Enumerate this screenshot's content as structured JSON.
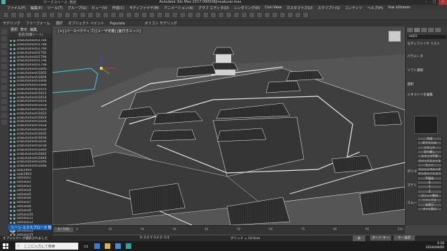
{
  "window": {
    "title": "Autodesk 3ds Max 2017    090506Jinsakurai.max",
    "workspace_label": "ワークスペース: 既定"
  },
  "menubar": [
    "ファイル(F)",
    "編集(E)",
    "ツール(T)",
    "グループ(G)",
    "ビュー(V)",
    "作成(C)",
    "モディファイヤ(M)",
    "アニメーション(A)",
    "グラフ エディタ(D)",
    "レンダリング(R)",
    "Civil View",
    "カスタマイズ(U)",
    "スクリプト(S)",
    "コンテンツ",
    "ヘルプ(H)",
    "Vue xStream"
  ],
  "ribbon": [
    "モデリング",
    "フリーフォーム",
    "選択",
    "オブジェクト ペイント",
    "Populate"
  ],
  "ribbon_sub": "ポリゴン モデリング",
  "explorer": {
    "tabs": [
      "選択",
      "表示",
      "編集"
    ],
    "header": "名前(昇順ソート)",
    "items": [
      "arakuhoheshi1786",
      "arakuhoheshi1788",
      "arakuhoheshi1790",
      "arakuhoheshi1792",
      "arakuhoheshi1794",
      "arakuhoheshi1796",
      "arakuhoheshi1798",
      "arakuhoheshi1800",
      "arakuhoheshi1802",
      "arakuhoheshi1804",
      "arakuhoheshi1806",
      "arakuhoheshi1808",
      "arakuhoheshi1810",
      "arakuhoheshi1812",
      "arakuhoheshi1814",
      "arakuhoheshi1816",
      "arakuhoheshi1818",
      "arakuhoheshi1820",
      "arakuhoheshi1822",
      "arakuhoheshi1824",
      "arakuhoheshi1826",
      "arakuhoheshi1828",
      "arakuhoheshi1830",
      "arakuhoheshi1832",
      "arakuhoheshi1834",
      "arakuhoheshi1836",
      "arakuhoheshi1838",
      "arakuhoheshi1840",
      "arakuhoheshi1842",
      "arakuhoheshi1844",
      "arakuhoheshi1846",
      "arakuhoheshi1848",
      "aoki2900",
      "aoki2902",
      "ashioka1",
      "ashioka2",
      "ashioka3",
      "ashioka4",
      "ashioka5",
      "ashioka6",
      "ashioka7",
      "ashioka8",
      "ashioka9",
      "ashioka10",
      "ashioka11",
      "ashioka12",
      "ashioka13",
      "ashioka14",
      "ashioka15",
      "ashioka16"
    ],
    "status": "シーン エクスプローラ  既定"
  },
  "viewport": {
    "label": "[+] [パースペクティブ] [ユーザ定義] [面付きエッジ]",
    "colors": {
      "bg": "#4b4b4b",
      "roof": "#2a2a2a",
      "wall": "#e0e0e0",
      "selection": "#2fd3e6",
      "gizmo_x": "#e03030",
      "gizmo_y": "#30c030",
      "gizmo_z": "#3050e0"
    }
  },
  "cmdpanel": {
    "name": "obj01",
    "sections": [
      "モディファイヤ リスト",
      "パラメータ",
      "ソフト選択",
      "選択",
      "ジオメトリを編集",
      "ポリゴン",
      "マテリアル ID",
      "スムージング グループ"
    ],
    "buttons": [
      "作成",
      "折りたたみ",
      "アタッチ",
      "切り離し",
      "スライス平面",
      "クイックスライス",
      "カット",
      "メッシュスムーズ",
      "テッセレーション",
      "平面化",
      "X",
      "Y",
      "Z",
      "グリッド整列",
      "リラックス",
      "非表示",
      "すべて表示"
    ]
  },
  "timeline": {
    "frame": "0 / 100",
    "ticks": [
      "0",
      "10",
      "20",
      "30",
      "40",
      "50",
      "60",
      "70",
      "80",
      "90",
      "100"
    ]
  },
  "status": {
    "left": "オブジェクトが選択されました",
    "coords": "X: 0.0   Y: 0.0   Z: 0.0",
    "grid": "グリッド = 10.0cm",
    "autokey": "オート キー",
    "setkey": "キー設定"
  },
  "taskbar": {
    "search": "ここに入力して検索",
    "time": "3:16",
    "date": "2016/04/05"
  }
}
